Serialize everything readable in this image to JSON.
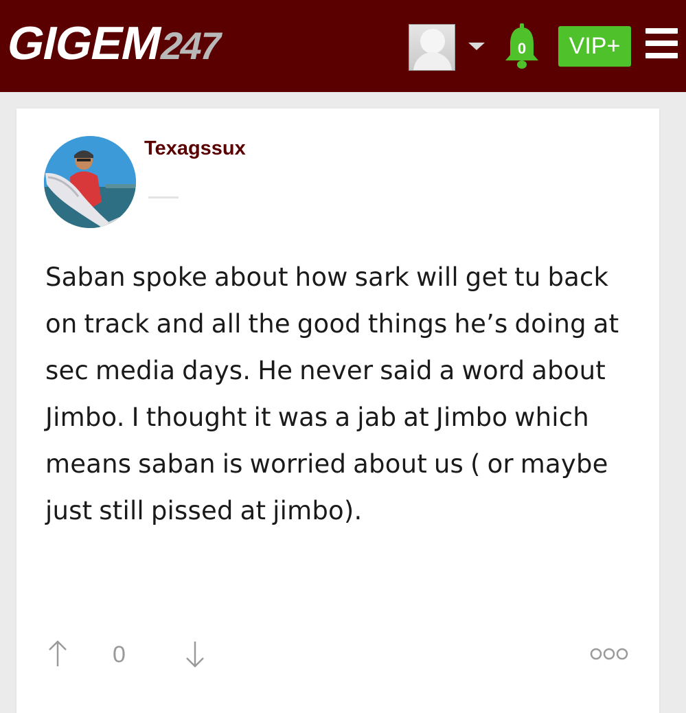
{
  "header": {
    "logo_main": "GIGEM",
    "logo_num": "247",
    "notification_count": "0",
    "vip_label": "VIP+",
    "icons": {
      "avatar": "default-user-avatar",
      "dropdown": "chevron-down-icon",
      "notifications": "bell-icon",
      "menu": "hamburger-menu-icon"
    }
  },
  "post": {
    "username": "Texagssux",
    "avatar": "user-photo-fisherman-holding-fish",
    "body": "Saban spoke about how sark will get tu back on track and all the good things he’s doing at sec media days. He never said a word about Jimbo. I thought it was a jab at Jimbo which means saban is worried about us ( or maybe just still pissed at jimbo).",
    "vote_count": "0",
    "icons": {
      "upvote": "arrow-up-icon",
      "downvote": "arrow-down-icon",
      "more": "more-options-icon"
    }
  },
  "colors": {
    "header_bg": "#5a0000",
    "vip_bg": "#4fc22b",
    "bell": "#4fc22b",
    "username": "#5a0000",
    "page_bg": "#ebebeb"
  }
}
